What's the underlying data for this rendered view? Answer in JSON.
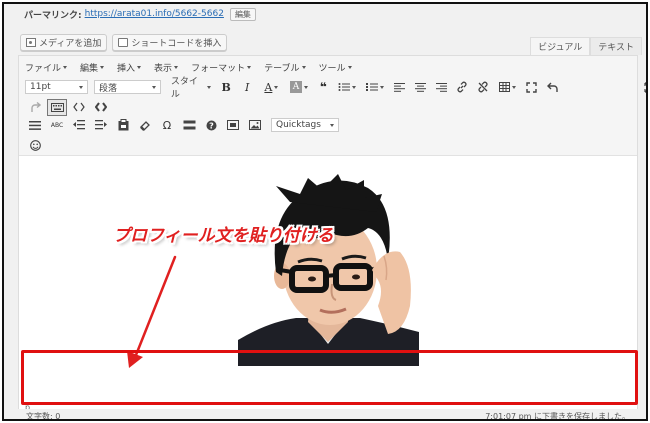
{
  "permalink": {
    "label": "パーマリンク:",
    "url": "https://arata01.info/5662-5662",
    "edit_label": "編集"
  },
  "media_buttons": {
    "add_media": "メディアを追加",
    "insert_shortcode": "ショートコードを挿入"
  },
  "tabs": {
    "visual": "ビジュアル",
    "text": "テキスト"
  },
  "menus": [
    "ファイル",
    "編集",
    "挿入",
    "表示",
    "フォーマット",
    "テーブル",
    "ツール"
  ],
  "toolbar": {
    "font_size": "11pt",
    "paragraph": "段落",
    "style": "スタイル",
    "bold": "B",
    "italic": "I",
    "underline_a": "A",
    "highlight_a": "A",
    "quote": "❝",
    "omega": "Ω",
    "spell": "ABC",
    "quicktags": "Quicktags"
  },
  "annotation": {
    "text": "プロフィール文を貼り付ける",
    "color": "#e02020"
  },
  "editor": {
    "paragraph_marker": "p"
  },
  "status": {
    "word_count": "文字数: 0",
    "saved": "7:01:07 pm に下書きを保存しました。"
  }
}
